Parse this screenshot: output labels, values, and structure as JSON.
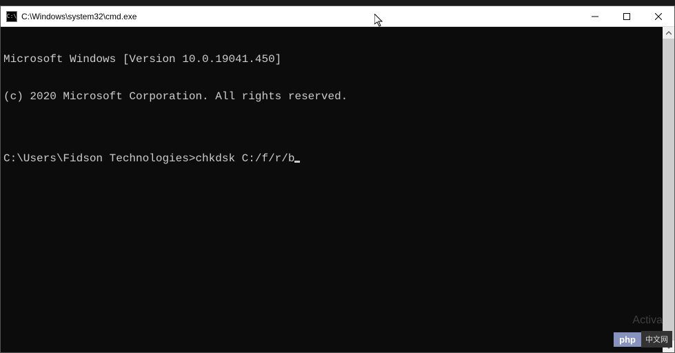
{
  "window": {
    "title": "C:\\Windows\\system32\\cmd.exe",
    "icon_label": "C:\\"
  },
  "terminal": {
    "lines": [
      "Microsoft Windows [Version 10.0.19041.450]",
      "(c) 2020 Microsoft Corporation. All rights reserved.",
      ""
    ],
    "prompt": "C:\\Users\\Fidson Technologies>",
    "command": "chkdsk C:/f/r/b"
  },
  "watermark": {
    "php": "php",
    "cn": "中文网"
  },
  "activate": "Activa"
}
